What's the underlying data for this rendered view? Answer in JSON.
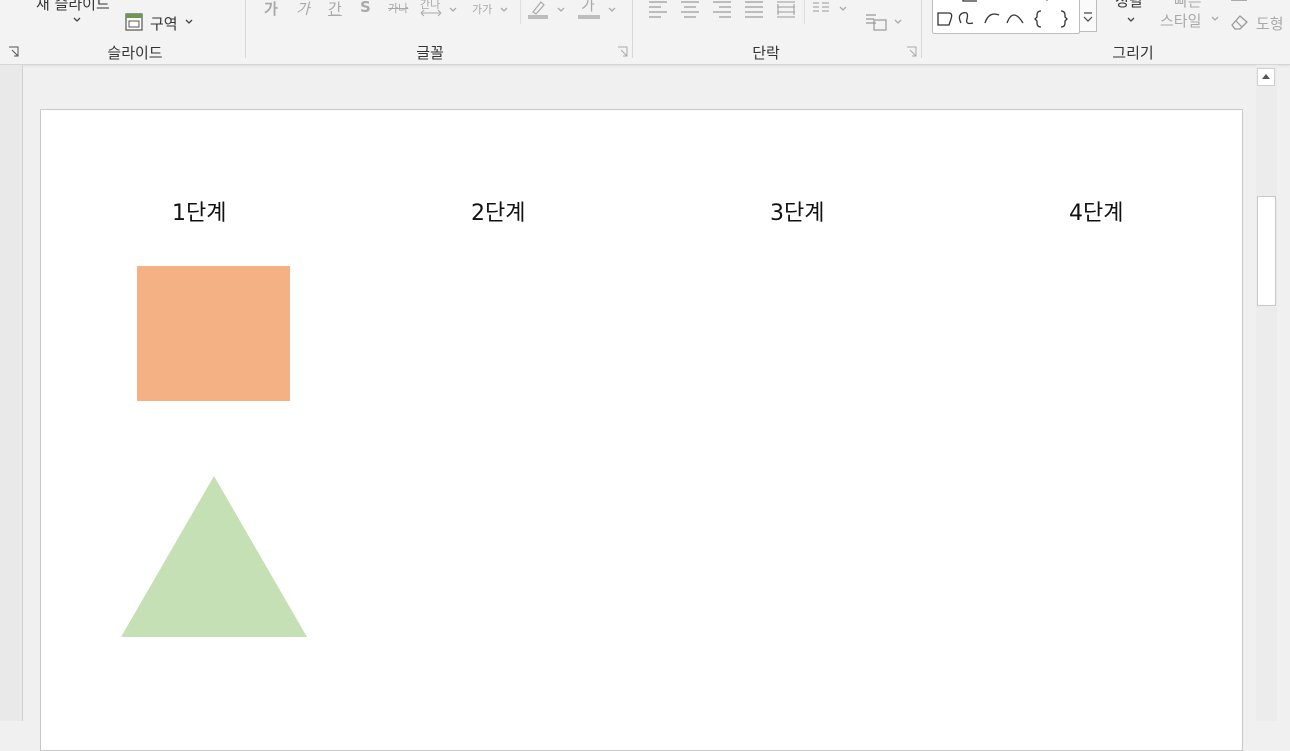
{
  "ribbon": {
    "slides_group": {
      "label": "슬라이드",
      "new_slide_label": "새 슬라이드",
      "section_label": "구역"
    },
    "font_group": {
      "label": "글꼴",
      "buttons": [
        "가",
        "가",
        "간",
        "S",
        "가나",
        "간나",
        "가가",
        "가"
      ]
    },
    "paragraph_group": {
      "label": "단락"
    },
    "drawing_group": {
      "label": "그리기",
      "arrange_label": "정렬",
      "quick_styles_top": "빠른",
      "quick_styles_label": "스타일",
      "shape_label": "도형"
    }
  },
  "slide": {
    "steps": [
      "1단계",
      "2단계",
      "3단계",
      "4단계"
    ],
    "colors": {
      "square": "#f4b183",
      "triangle": "#c5e0b4"
    }
  }
}
